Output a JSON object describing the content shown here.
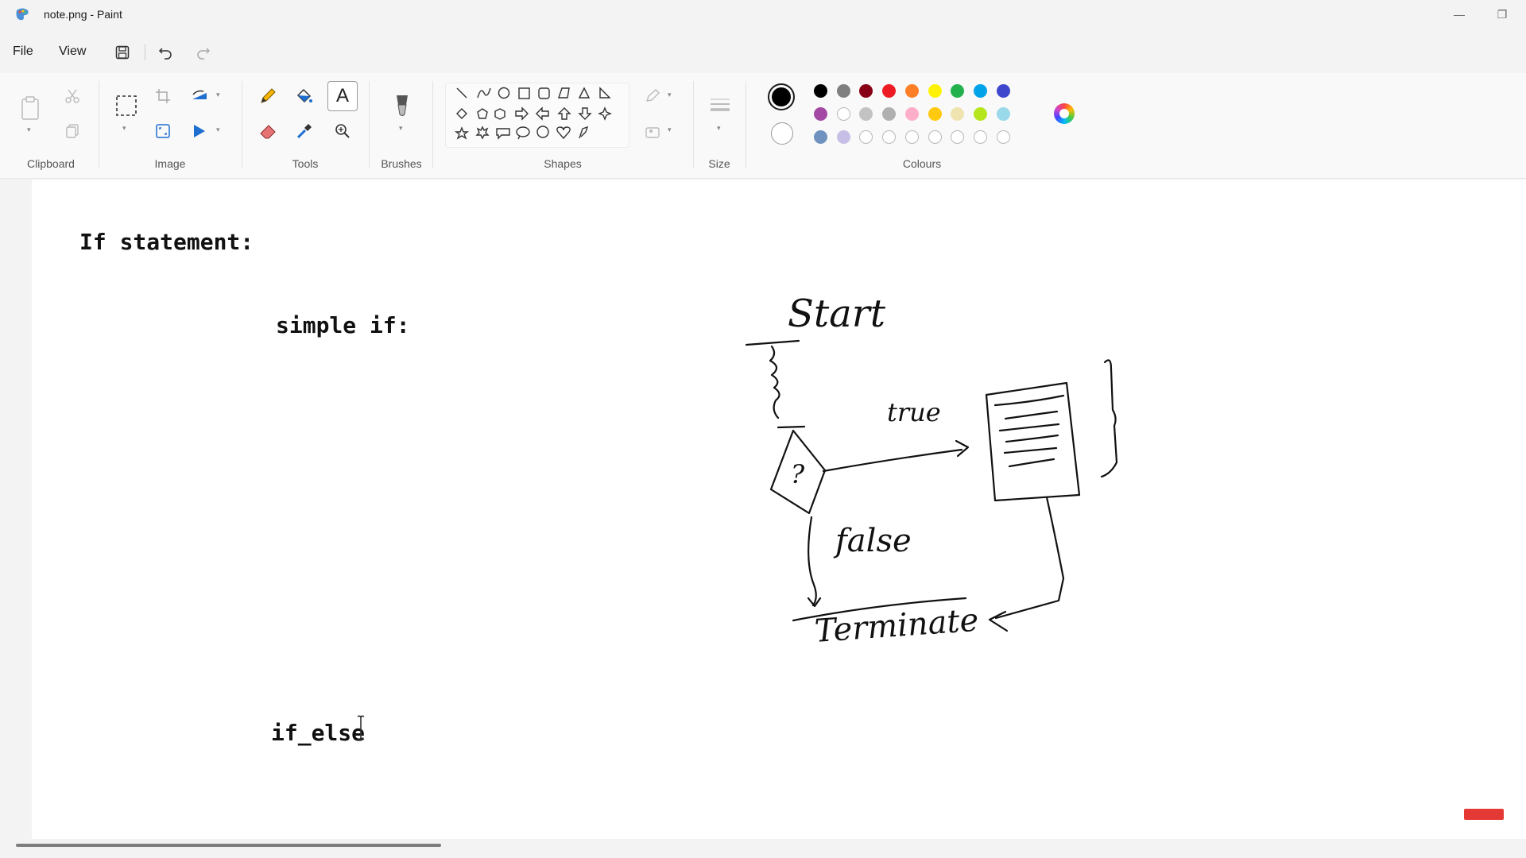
{
  "window": {
    "title": "note.png - Paint",
    "minimize_glyph": "—",
    "restore_glyph": "❐"
  },
  "menu": {
    "file": "File",
    "view": "View"
  },
  "ribbon": {
    "groups": {
      "clipboard": "Clipboard",
      "image": "Image",
      "tools": "Tools",
      "brushes": "Brushes",
      "shapes": "Shapes",
      "size": "Size",
      "colours": "Colours"
    },
    "text_tool_glyph": "A"
  },
  "colours": {
    "primary": "#000000",
    "secondary": "#ffffff",
    "palette_row1": [
      "#000000",
      "#7f7f7f",
      "#880015",
      "#ed1c24",
      "#ff7f27",
      "#fff200",
      "#22b14c",
      "#00a2e8",
      "#3f48cc"
    ],
    "palette_row2": [
      "#a349a4",
      "#ffffff",
      "#c3c3c3",
      "#b0b0b0",
      "#ffaec9",
      "#ffc90e",
      "#efe4b0",
      "#b5e61d",
      "#99d9ea"
    ],
    "palette_row3": [
      "#7092be",
      "#c8bfe7",
      "#ffffff",
      "#ffffff",
      "#ffffff",
      "#ffffff",
      "#ffffff",
      "#ffffff",
      "#ffffff"
    ]
  },
  "canvas": {
    "heading": "If statement:",
    "subheading": "simple if:",
    "ifelse": "if_else"
  },
  "drawing": {
    "start": "Start",
    "true": "true",
    "false": "false",
    "terminate": "Terminate",
    "question": "?"
  }
}
